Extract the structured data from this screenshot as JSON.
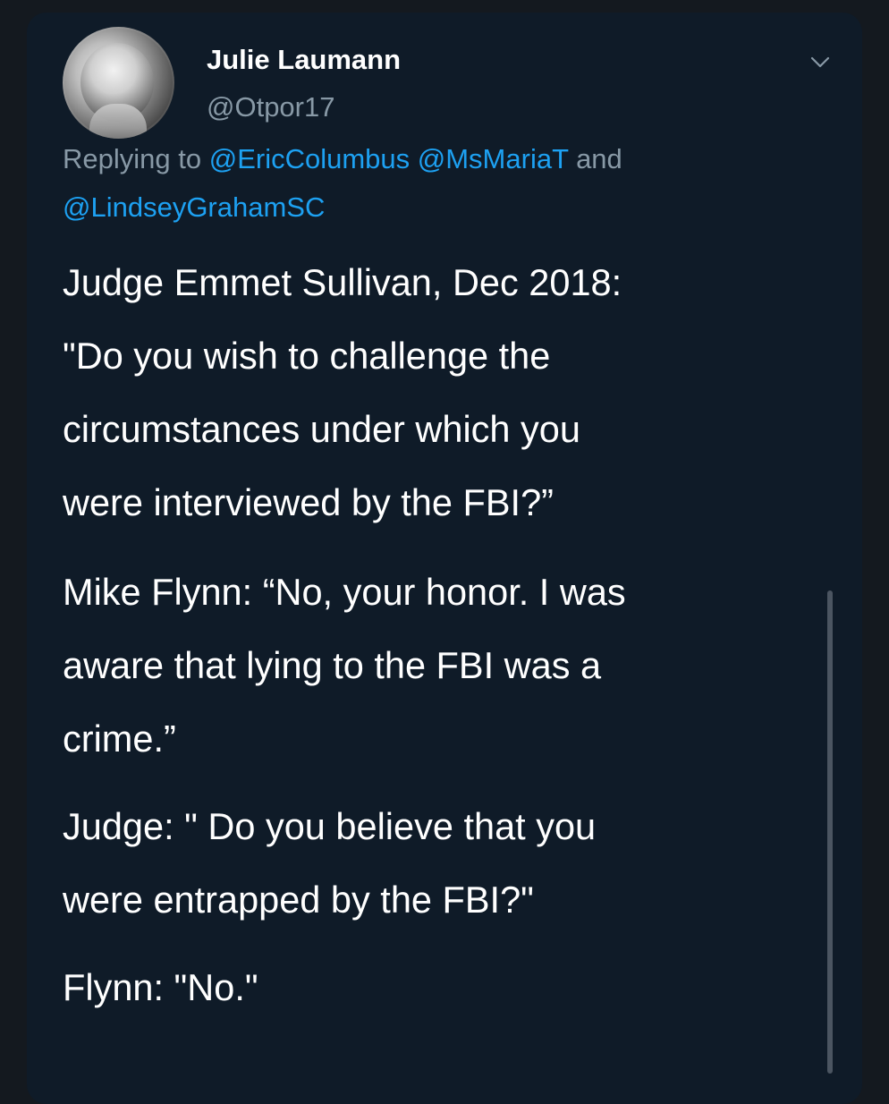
{
  "tweet": {
    "author_name": "Julie Laumann",
    "author_handle": "@Otpor17",
    "reply": {
      "prefix": "Replying to ",
      "mention_1": "@EricColumbus",
      "mention_2": "@MsMariaT",
      "conjunction": " and",
      "mention_3": "@LindseyGrahamSC"
    },
    "body_lines": [
      "Judge Emmet Sullivan, Dec 2018:",
      "\"Do you wish to challenge the",
      "circumstances under which you",
      "were interviewed by the FBI?”",
      "Mike Flynn: “No, your honor. I was",
      "aware that lying to the FBI was a",
      "crime.”",
      "Judge: \" Do you believe that you",
      "were entrapped by the FBI?\"",
      "Flynn: \"No.\""
    ]
  },
  "icons": {
    "avatar": "avatar-photo",
    "menu": "chevron-down-icon"
  },
  "colors": {
    "background": "#14191f",
    "card": "#0f1b28",
    "text_primary": "#ffffff",
    "text_secondary": "#8899a6",
    "link": "#1da1f2"
  }
}
